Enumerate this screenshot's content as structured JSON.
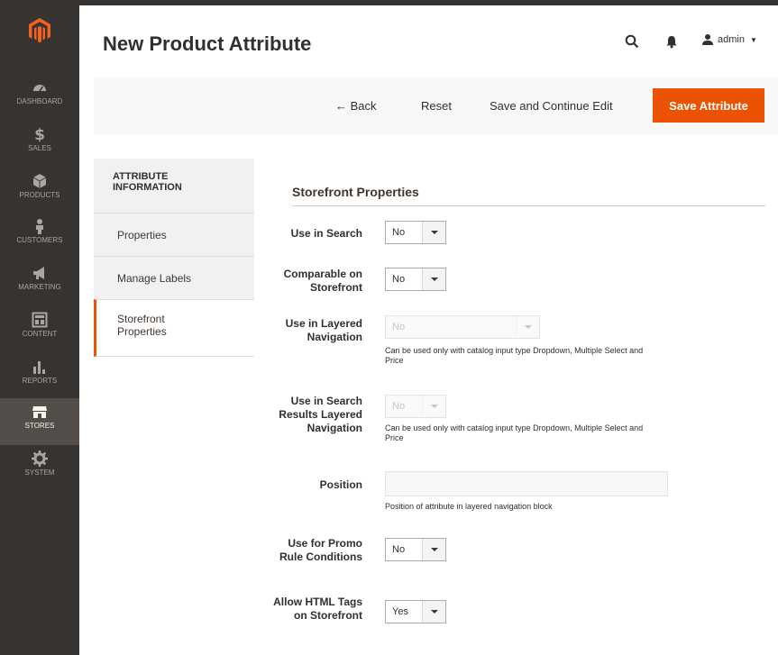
{
  "header": {
    "title": "New Product Attribute",
    "user_name": "admin"
  },
  "sidebar": {
    "items": [
      {
        "label": "DASHBOARD",
        "icon": "dashboard-icon"
      },
      {
        "label": "SALES",
        "icon": "dollar-icon"
      },
      {
        "label": "PRODUCTS",
        "icon": "cube-icon"
      },
      {
        "label": "CUSTOMERS",
        "icon": "person-icon"
      },
      {
        "label": "MARKETING",
        "icon": "megaphone-icon"
      },
      {
        "label": "CONTENT",
        "icon": "layout-icon"
      },
      {
        "label": "REPORTS",
        "icon": "bar-chart-icon"
      },
      {
        "label": "STORES",
        "icon": "store-icon"
      },
      {
        "label": "SYSTEM",
        "icon": "gear-icon"
      }
    ],
    "active": "STORES"
  },
  "actions": {
    "back": "← Back",
    "reset": "Reset",
    "save_continue": "Save and Continue Edit",
    "save": "Save Attribute"
  },
  "tabs": {
    "heading": "ATTRIBUTE INFORMATION",
    "items": [
      "Properties",
      "Manage Labels",
      "Storefront Properties"
    ],
    "active": "Storefront Properties"
  },
  "section": {
    "title": "Storefront Properties"
  },
  "fields": {
    "use_in_search": {
      "label": "Use in Search",
      "value": "No"
    },
    "comparable": {
      "label": "Comparable on Storefront",
      "value": "No"
    },
    "layered_nav": {
      "label": "Use in Layered Navigation",
      "value": "No",
      "note": "Can be used only with catalog input type Dropdown, Multiple Select and Price"
    },
    "search_layered_nav": {
      "label": "Use in Search Results Layered Navigation",
      "value": "No",
      "note": "Can be used only with catalog input type Dropdown, Multiple Select and Price"
    },
    "position": {
      "label": "Position",
      "value": "",
      "note": "Position of attribute in layered navigation block"
    },
    "promo_rule": {
      "label": "Use for Promo Rule Conditions",
      "value": "No"
    },
    "html_tags": {
      "label": "Allow HTML Tags on Storefront",
      "value": "Yes"
    }
  },
  "colors": {
    "accent": "#eb5202",
    "sidebar_bg": "#373330",
    "sidebar_active": "#524d49"
  }
}
